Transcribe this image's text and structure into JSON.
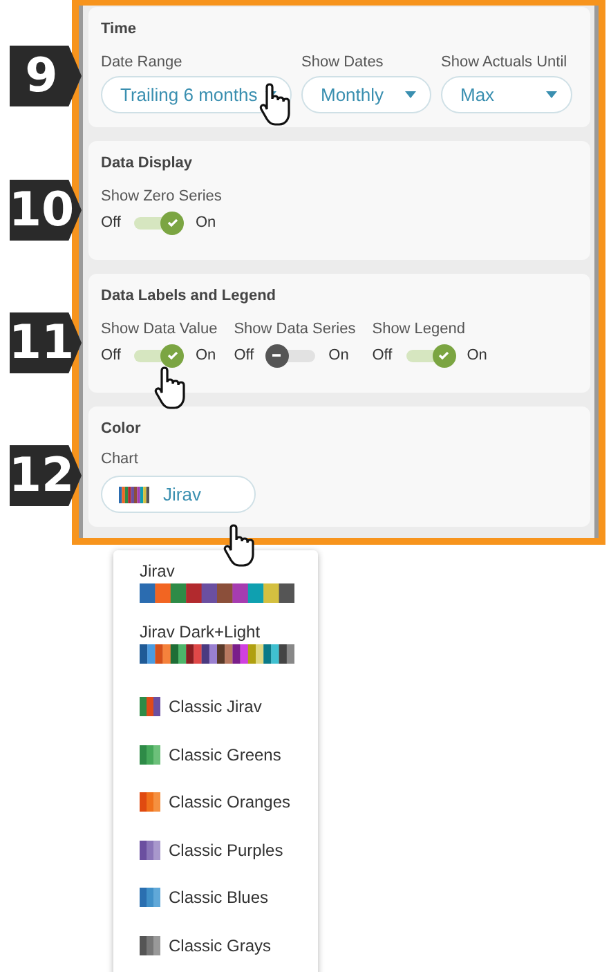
{
  "sections": [
    {
      "badge": "9",
      "title": "Time",
      "kind": "selects",
      "fields": [
        {
          "label": "Date Range",
          "value": "Trailing 6 months"
        },
        {
          "label": "Show Dates",
          "value": "Monthly"
        },
        {
          "label": "Show Actuals Until",
          "value": "Max"
        }
      ]
    },
    {
      "badge": "10",
      "title": "Data Display",
      "kind": "toggles",
      "toggles": [
        {
          "label": "Show Zero Series",
          "off": "Off",
          "on": "On",
          "checked": true
        }
      ]
    },
    {
      "badge": "11",
      "title": "Data Labels and Legend",
      "kind": "toggles",
      "toggles": [
        {
          "label": "Show Data Value",
          "off": "Off",
          "on": "On",
          "checked": true
        },
        {
          "label": "Show Data Series",
          "off": "Off",
          "on": "On",
          "checked": false
        },
        {
          "label": "Show Legend",
          "off": "Off",
          "on": "On",
          "checked": true
        }
      ]
    },
    {
      "badge": "12",
      "title": "Color",
      "kind": "palette",
      "field": {
        "label": "Chart",
        "value": "Jirav"
      }
    }
  ],
  "palette_menu": {
    "options": [
      {
        "label": "Jirav",
        "kind": "strip"
      },
      {
        "label": "Jirav Dark+Light",
        "kind": "strip"
      },
      {
        "label": "Classic Jirav",
        "kind": "chip"
      },
      {
        "label": "Classic Greens",
        "kind": "chip"
      },
      {
        "label": "Classic Oranges",
        "kind": "chip"
      },
      {
        "label": "Classic Purples",
        "kind": "chip"
      },
      {
        "label": "Classic Blues",
        "kind": "chip"
      },
      {
        "label": "Classic Grays",
        "kind": "chip"
      }
    ]
  }
}
